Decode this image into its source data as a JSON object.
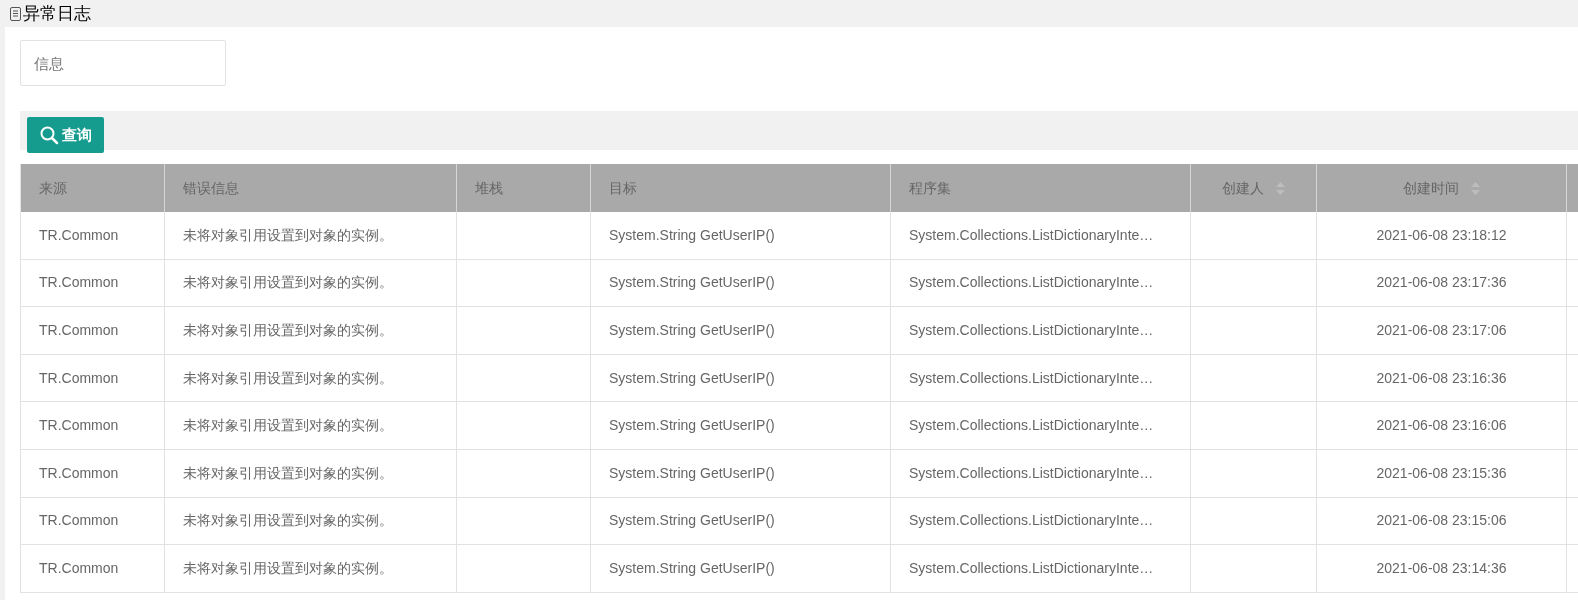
{
  "page_title": "异常日志",
  "search": {
    "placeholder": "信息"
  },
  "query_button": "查询",
  "table": {
    "columns": [
      {
        "label": "来源",
        "sortable": false
      },
      {
        "label": "错误信息",
        "sortable": false
      },
      {
        "label": "堆栈",
        "sortable": false
      },
      {
        "label": "目标",
        "sortable": false
      },
      {
        "label": "程序集",
        "sortable": false
      },
      {
        "label": "创建人",
        "sortable": true
      },
      {
        "label": "创建时间",
        "sortable": true
      }
    ],
    "rows": [
      [
        "TR.Common",
        "未将对象引用设置到对象的实例。",
        "",
        "System.String GetUserIP()",
        "System.Collections.ListDictionaryInte…",
        "",
        "2021-06-08 23:18:12"
      ],
      [
        "TR.Common",
        "未将对象引用设置到对象的实例。",
        "",
        "System.String GetUserIP()",
        "System.Collections.ListDictionaryInte…",
        "",
        "2021-06-08 23:17:36"
      ],
      [
        "TR.Common",
        "未将对象引用设置到对象的实例。",
        "",
        "System.String GetUserIP()",
        "System.Collections.ListDictionaryInte…",
        "",
        "2021-06-08 23:17:06"
      ],
      [
        "TR.Common",
        "未将对象引用设置到对象的实例。",
        "",
        "System.String GetUserIP()",
        "System.Collections.ListDictionaryInte…",
        "",
        "2021-06-08 23:16:36"
      ],
      [
        "TR.Common",
        "未将对象引用设置到对象的实例。",
        "",
        "System.String GetUserIP()",
        "System.Collections.ListDictionaryInte…",
        "",
        "2021-06-08 23:16:06"
      ],
      [
        "TR.Common",
        "未将对象引用设置到对象的实例。",
        "",
        "System.String GetUserIP()",
        "System.Collections.ListDictionaryInte…",
        "",
        "2021-06-08 23:15:36"
      ],
      [
        "TR.Common",
        "未将对象引用设置到对象的实例。",
        "",
        "System.String GetUserIP()",
        "System.Collections.ListDictionaryInte…",
        "",
        "2021-06-08 23:15:06"
      ],
      [
        "TR.Common",
        "未将对象引用设置到对象的实例。",
        "",
        "System.String GetUserIP()",
        "System.Collections.ListDictionaryInte…",
        "",
        "2021-06-08 23:14:36"
      ]
    ]
  }
}
